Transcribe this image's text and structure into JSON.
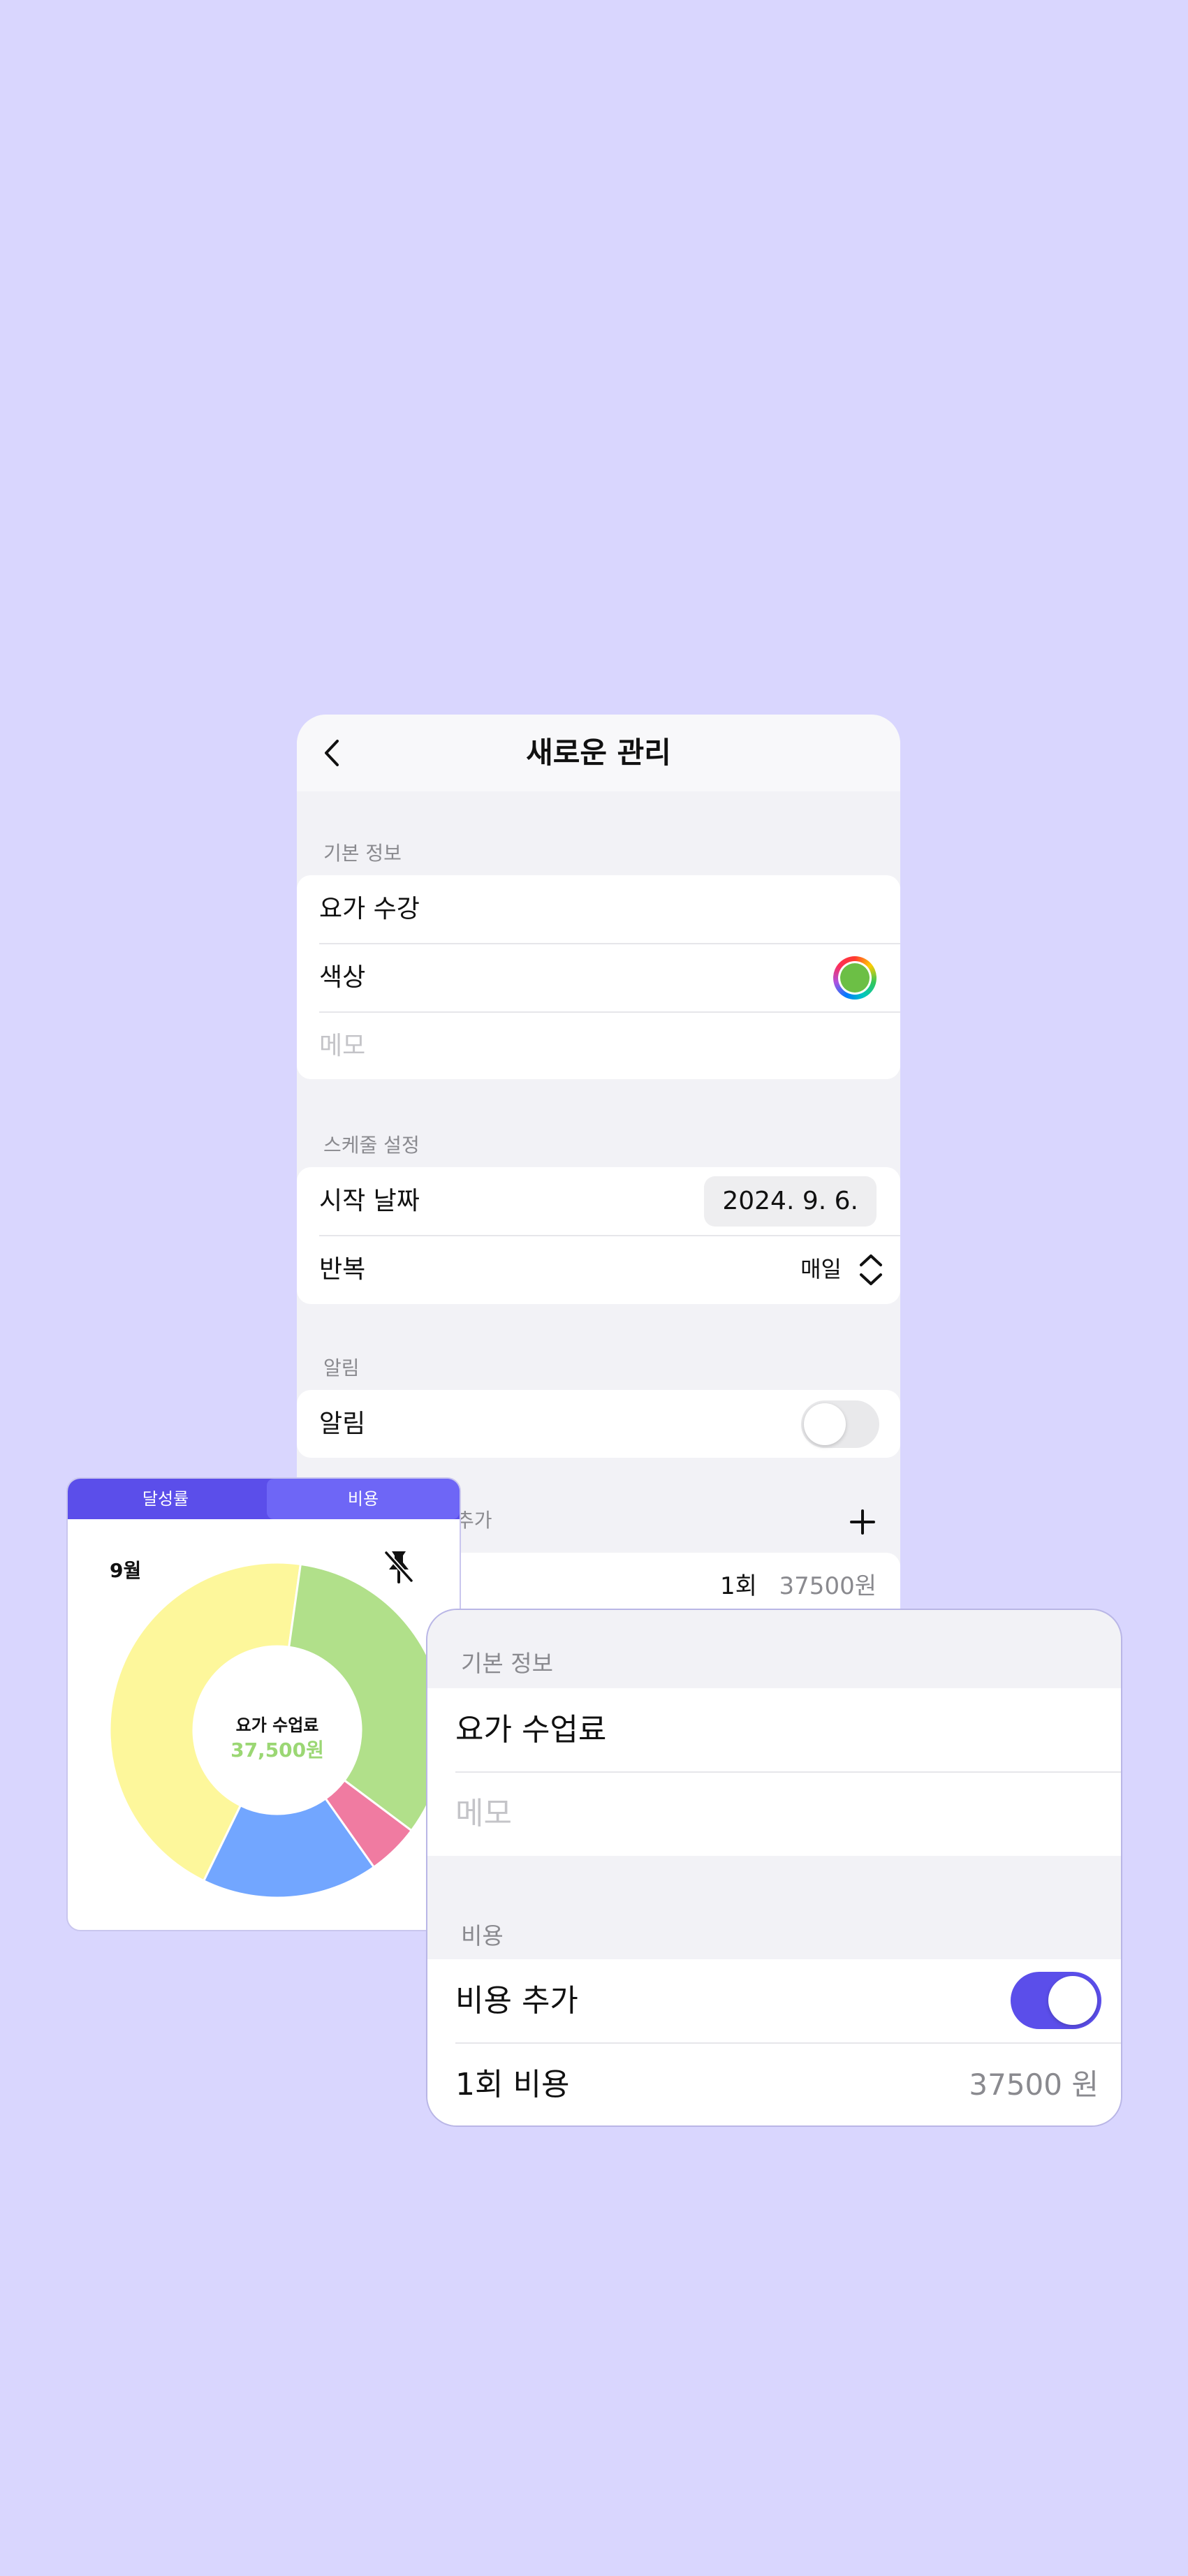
{
  "main": {
    "title": "새로운 관리",
    "basic_info": {
      "label": "기본 정보",
      "name": "요가 수강",
      "color_label": "색상",
      "memo_placeholder": "메모"
    },
    "schedule": {
      "label": "스케줄 설정",
      "start_date_label": "시작 날짜",
      "start_date_value": "2024. 9. 6.",
      "repeat_label": "반복",
      "repeat_value": "매일"
    },
    "alarm": {
      "label": "알림",
      "toggle_label": "알림",
      "enabled": false
    },
    "cost_section": {
      "label": "추가",
      "count": "1회",
      "amount": "37500원"
    }
  },
  "chart_card": {
    "tabs": [
      "달성률",
      "비용"
    ],
    "selected_tab": "비용",
    "month": "9월",
    "center_title": "요가 수업료",
    "center_value": "37,500원"
  },
  "chart_data": {
    "type": "pie",
    "categories": [
      "노랑",
      "초록",
      "분홍",
      "파랑"
    ],
    "values": [
      45,
      33,
      5,
      17
    ],
    "colors": [
      "#fdf79b",
      "#b1e08a",
      "#f07ba1",
      "#72a6ff"
    ]
  },
  "sheet": {
    "basic_info": {
      "label": "기본 정보",
      "name": "요가 수업료",
      "memo_placeholder": "메모"
    },
    "cost": {
      "label": "비용",
      "add_cost_label": "비용 추가",
      "add_cost_enabled": true,
      "per_time_label": "1회 비용",
      "per_time_value": "37500 원"
    }
  }
}
